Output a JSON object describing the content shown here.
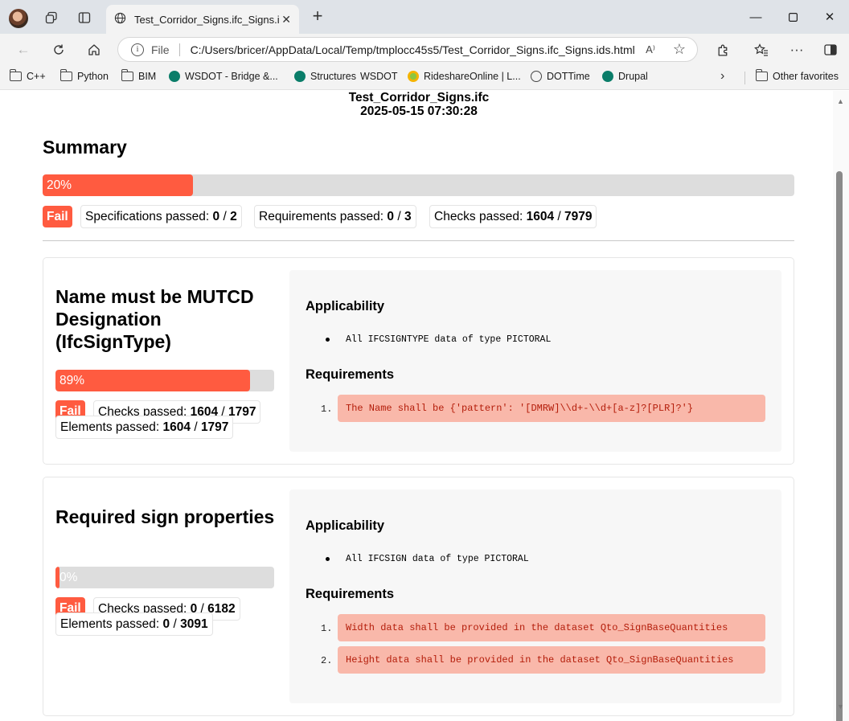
{
  "browser": {
    "tab_title": "Test_Corridor_Signs.ifc_Signs.ids.h",
    "file_label": "File",
    "url": "C:/Users/bricer/AppData/Local/Temp/tmplocc45s5/Test_Corridor_Signs.ifc_Signs.ids.html",
    "read_aloud": "A⁾"
  },
  "bookmarks": [
    {
      "label": "C++",
      "icon": "folder"
    },
    {
      "label": "Python",
      "icon": "folder"
    },
    {
      "label": "BIM",
      "icon": "folder"
    },
    {
      "label": "WSDOT - Bridge &...",
      "icon": "wsdot-logo"
    },
    {
      "label": "Structures",
      "icon": "wsdot-logo"
    },
    {
      "label": "WSDOT",
      "icon": "none"
    },
    {
      "label": "RideshareOnline | L...",
      "icon": "rideshare-logo"
    },
    {
      "label": "DOTTime",
      "icon": "globe"
    },
    {
      "label": "Drupal",
      "icon": "wsdot-logo"
    },
    {
      "label": "Other favorites",
      "icon": "folder"
    }
  ],
  "report": {
    "file_name": "Test_Corridor_Signs.ifc",
    "timestamp": "2025-05-15 07:30:28",
    "summary": {
      "title": "Summary",
      "percent_label": "20%",
      "percent": 20,
      "status": "Fail",
      "specifications_label": "Specifications passed:",
      "specifications_passed": "0",
      "specifications_total": "2",
      "requirements_label": "Requirements passed:",
      "requirements_passed": "0",
      "requirements_total": "3",
      "checks_label": "Checks passed:",
      "checks_passed": "1604",
      "checks_total": "7979"
    },
    "specifications": [
      {
        "title": "Name must be MUTCD Designation (IfcSignType)",
        "percent_label": "89%",
        "percent": 89,
        "status": "Fail",
        "checks_label": "Checks passed:",
        "checks_passed": "1604",
        "checks_total": "1797",
        "elements_label": "Elements passed:",
        "elements_passed": "1604",
        "elements_total": "1797",
        "applicability_heading": "Applicability",
        "applicability": [
          "All IFCSIGNTYPE data of type PICTORAL"
        ],
        "requirements_heading": "Requirements",
        "requirements": [
          "The Name shall be {'pattern': '[DMRW]\\\\d+-\\\\d+[a-z]?[PLR]?'}"
        ]
      },
      {
        "title": "Required sign properties",
        "percent_label": "0%",
        "percent": 0,
        "status": "Fail",
        "checks_label": "Checks passed:",
        "checks_passed": "0",
        "checks_total": "6182",
        "elements_label": "Elements passed:",
        "elements_passed": "0",
        "elements_total": "3091",
        "applicability_heading": "Applicability",
        "applicability": [
          "All IFCSIGN data of type PICTORAL"
        ],
        "requirements_heading": "Requirements",
        "requirements": [
          "Width data shall be provided in the dataset Qto_SignBaseQuantities",
          "Height data shall be provided in the dataset Qto_SignBaseQuantities"
        ]
      }
    ]
  },
  "colors": {
    "fail": "#ff5b40",
    "progress_track": "#dddddd",
    "requirement_bg": "#f9b8aa",
    "requirement_text": "#b41d0a"
  }
}
